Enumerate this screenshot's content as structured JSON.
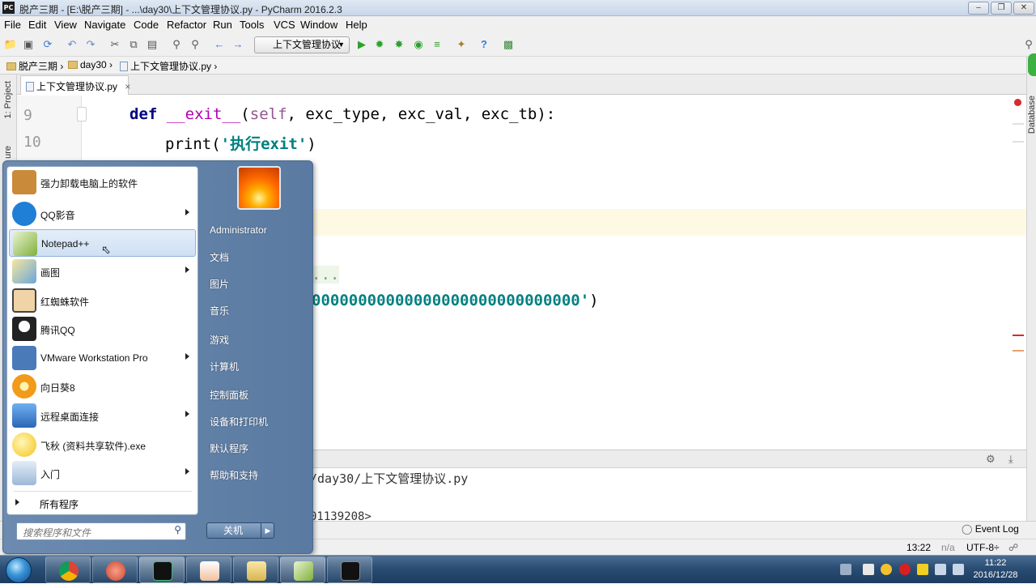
{
  "window": {
    "title": "脱产三期 - [E:\\脱产三期] - ...\\day30\\上下文管理协议.py - PyCharm 2016.2.3",
    "app_icon_text": "PC"
  },
  "menu": [
    "File",
    "Edit",
    "View",
    "Navigate",
    "Code",
    "Refactor",
    "Run",
    "Tools",
    "VCS",
    "Window",
    "Help"
  ],
  "toolbar": {
    "run_config": "上下文管理协议"
  },
  "breadcrumb": [
    "脱产三期",
    "day30",
    "上下文管理协议.py"
  ],
  "side_tools": {
    "project": "1: Project",
    "structure": "ure",
    "database": "Database"
  },
  "tab": {
    "label": "上下文管理协议.py",
    "close": "×"
  },
  "editor": {
    "line_numbers": [
      "9",
      "10"
    ],
    "code": {
      "l9_def": "def",
      "l9_name": "__exit__",
      "l9_open": "(",
      "l9_self": "self",
      "l9_rest": ", exc_type, exc_val, exc_tb):",
      "l10_print": "print(",
      "l10_str": "'执行exit'",
      "l10_close": ")",
      "l15_dots": "...",
      "l16_str": "00000000000000000000000000000'",
      "l16_close": ")"
    }
  },
  "run_panel": {
    "path_line": "/day30/上下文管理协议.py",
    "addr_line": "01139208>"
  },
  "status": {
    "event_log": "Event Log",
    "position": "13:22",
    "na": "n/a",
    "encoding": "UTF-8÷"
  },
  "start_menu": {
    "programs": [
      {
        "label": "强力卸载电脑上的软件",
        "submenu": false,
        "color": "#c98a3a"
      },
      {
        "label": "QQ影音",
        "submenu": true,
        "color": "#1f7fd6"
      },
      {
        "label": "Notepad++",
        "submenu": false,
        "color": "#7fb03a"
      },
      {
        "label": "画图",
        "submenu": true,
        "color": "#6aa6d8"
      },
      {
        "label": "红蜘蛛软件",
        "submenu": false,
        "color": "#444444"
      },
      {
        "label": "腾讯QQ",
        "submenu": false,
        "color": "#222222"
      },
      {
        "label": "VMware Workstation Pro",
        "submenu": true,
        "color": "#4a7ab8"
      },
      {
        "label": "向日葵8",
        "submenu": false,
        "color": "#f29a1a"
      },
      {
        "label": "远程桌面连接",
        "submenu": true,
        "color": "#2b66b5"
      },
      {
        "label": "飞秋 (资料共享软件).exe",
        "submenu": false,
        "color": "#f4c21a"
      },
      {
        "label": "入门",
        "submenu": true,
        "color": "#9cb8d6"
      }
    ],
    "all_programs": "所有程序",
    "search_placeholder": "搜索程序和文件",
    "user": "Administrator",
    "links": [
      "文档",
      "图片",
      "音乐",
      "游戏",
      "计算机",
      "控制面板",
      "设备和打印机",
      "默认程序",
      "帮助和支持"
    ],
    "shutdown": "关机"
  },
  "taskbar": {
    "buttons": [
      "chrome",
      "snagit",
      "pycharm",
      "screen-recorder",
      "file-explorer",
      "notepad-plus-plus",
      "cmd"
    ],
    "time": "11:22",
    "date": "2016/12/28"
  }
}
